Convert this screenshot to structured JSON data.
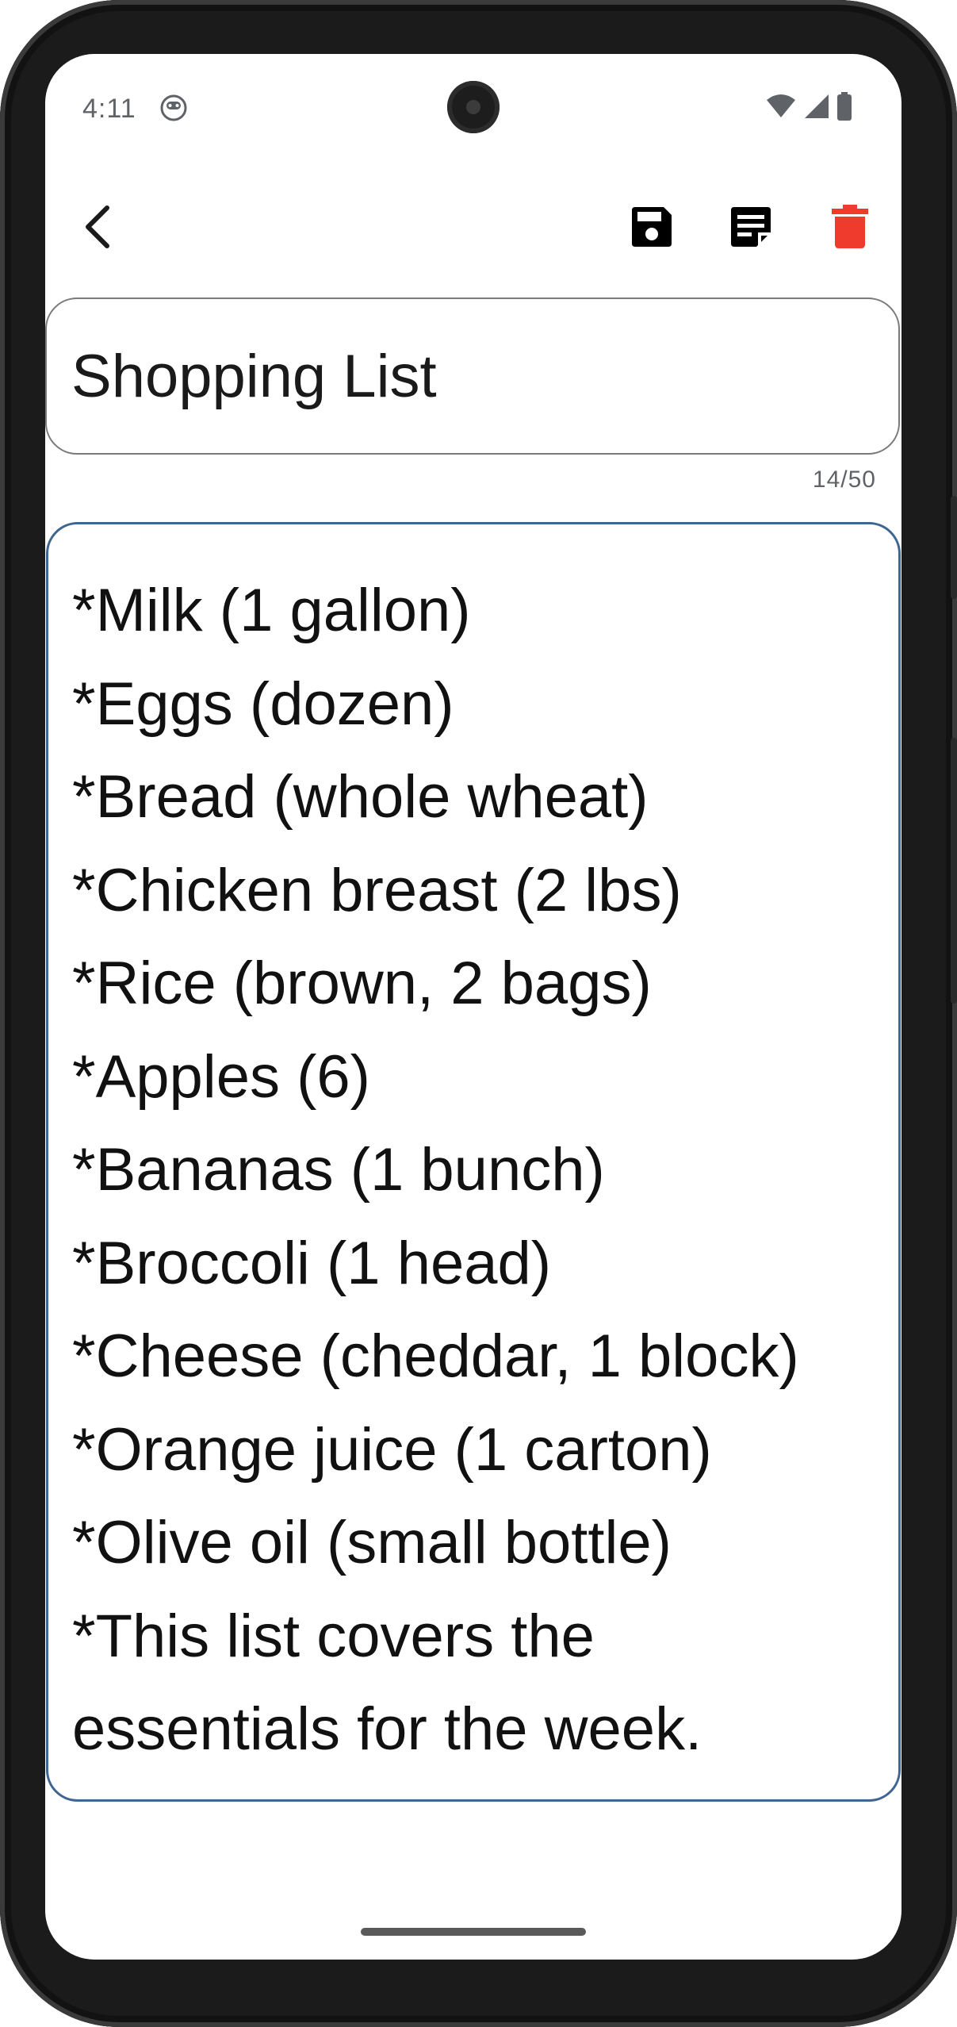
{
  "status_bar": {
    "time": "4:11",
    "icons": [
      "face-notification-icon",
      "wifi-icon",
      "signal-icon",
      "battery-icon"
    ]
  },
  "app_bar": {
    "actions": [
      "back-arrow-icon",
      "save-icon",
      "note-icon",
      "delete-icon"
    ],
    "delete_color": "#ef3b2d",
    "icon_color": "#000000"
  },
  "note": {
    "title": "Shopping List",
    "title_counter": "14/50",
    "body_lines": [
      "*Milk (1 gallon)",
      "*Eggs (dozen)",
      "*Bread (whole wheat)",
      "*Chicken breast (2 lbs)",
      "*Rice (brown, 2 bags)",
      "*Apples (6)",
      "*Bananas (1 bunch)",
      "*Broccoli (1 head)",
      "*Cheese (cheddar, 1 block)",
      "*Orange juice (1 carton)",
      "*Olive oil (small bottle)",
      "*This list covers the",
      "essentials for the week."
    ]
  },
  "colors": {
    "focused_border": "#3f6690",
    "unfocused_border": "#7a7a7a"
  }
}
